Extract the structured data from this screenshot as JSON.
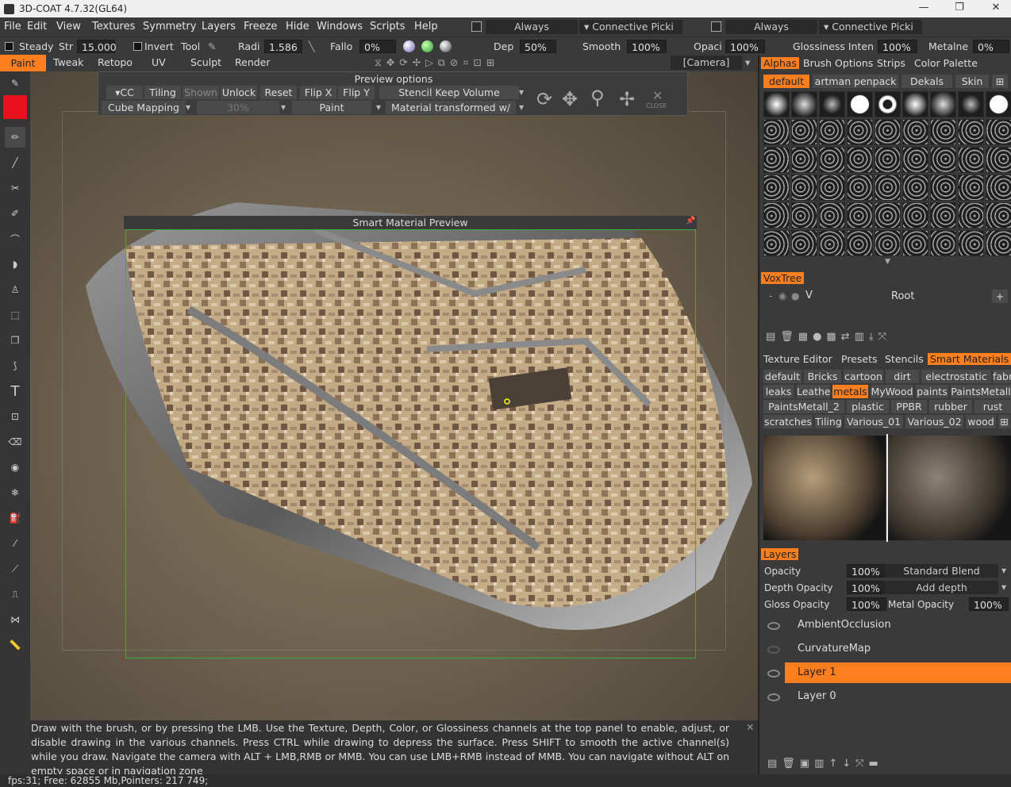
{
  "window": {
    "title": "3D-COAT 4.7.32(GL64)",
    "minimize": "—",
    "maximize": "❐",
    "close": "✕"
  },
  "menu": [
    "File",
    "Edit",
    "View",
    "Textures",
    "Symmetry",
    "Layers",
    "Freeze",
    "Hide",
    "Windows",
    "Scripts",
    "Help"
  ],
  "menu_right": {
    "always1": "Always",
    "connective1": "Connective Picki",
    "always2": "Always",
    "connective2": "Connective Picki"
  },
  "toolbar": {
    "steady": "Steady",
    "strength_label": "Str",
    "strength": "15.000",
    "invert": "Invert",
    "tool": "Tool",
    "radius_label": "Radi",
    "radius": "1.586",
    "falloff_label": "Fallo",
    "falloff": "0%",
    "depth_label": "Dep",
    "depth": "50%",
    "smooth_label": "Smooth",
    "smooth": "100%",
    "opacity_label": "Opaci",
    "opacity": "100%",
    "gloss_label": "Glossiness Inten",
    "gloss": "100%",
    "metal_label": "Metalne",
    "metal": "0%"
  },
  "modes": [
    "Paint",
    "Tweak",
    "Retopo",
    "UV",
    "Sculpt",
    "Render"
  ],
  "camera": "[Camera]",
  "preview": {
    "title": "Preview options",
    "cc": "CC",
    "tiling": "Tiling",
    "shown": "Shown",
    "unlock": "Unlock",
    "reset": "Reset",
    "flipx": "Flip X",
    "flipy": "Flip Y",
    "stencil": "Stencil Keep Volume",
    "cube": "Cube Mapping",
    "percent": "30%",
    "paint": "Paint",
    "material": "Material transformed w/",
    "close": "CLOSE"
  },
  "smart_material_preview": "Smart Material Preview",
  "hint": "Draw with the brush, or by pressing the LMB. Use the Texture, Depth, Color, or Glossiness channels at the top panel to enable, adjust, or disable drawing in the various channels. Press CTRL while drawing to depress the surface. Press SHIFT to smooth the active channel(s) while you draw. Navigate the camera with ALT + LMB,RMB or MMB. You can use LMB+RMB instead of MMB. You can navigate without ALT on empty space or in navigation zone",
  "status": "fps:31;    Free: 62855 Mb,Pointers: 217 749;",
  "right": {
    "top_tabs": [
      "Alphas",
      "Brush Options",
      "Strips",
      "Color Palette"
    ],
    "alpha_tabs": [
      "default",
      "artman penpack",
      "Dekals",
      "Skin"
    ],
    "voxtree": "VoxTree",
    "root_v": "V",
    "root": "Root",
    "mid_tabs": [
      "Texture Editor",
      "Presets",
      "Stencils",
      "Smart Materials"
    ],
    "mat_row1": [
      "default",
      "Bricks",
      "cartoon",
      "dirt",
      "electrostatic",
      "fabric"
    ],
    "mat_row2": [
      "leaks",
      "Leather",
      "metals",
      "MyWood",
      "paints",
      "PaintsMetall"
    ],
    "mat_row3": [
      "PaintsMetall_2",
      "plastic",
      "PPBR",
      "rubber",
      "rust"
    ],
    "mat_row4": [
      "scratches",
      "Tiling",
      "Various_01",
      "Various_02",
      "wood"
    ],
    "layers_title": "Layers",
    "opacity_label": "Opacity",
    "opacity": "100%",
    "blend": "Standard Blend",
    "depth_opacity_label": "Depth Opacity",
    "depth_opacity": "100%",
    "add_depth": "Add depth",
    "gloss_opacity_label": "Gloss Opacity",
    "gloss_opacity": "100%",
    "metal_opacity_label": "Metal Opacity",
    "metal_opacity": "100%",
    "layers": [
      "AmbientOcclusion",
      "CurvatureMap",
      "Layer 1",
      "Layer 0"
    ]
  },
  "colors": {
    "accent": "#ff7f1f",
    "primary_color": "#e8101c",
    "frame": "#3ab03a"
  }
}
